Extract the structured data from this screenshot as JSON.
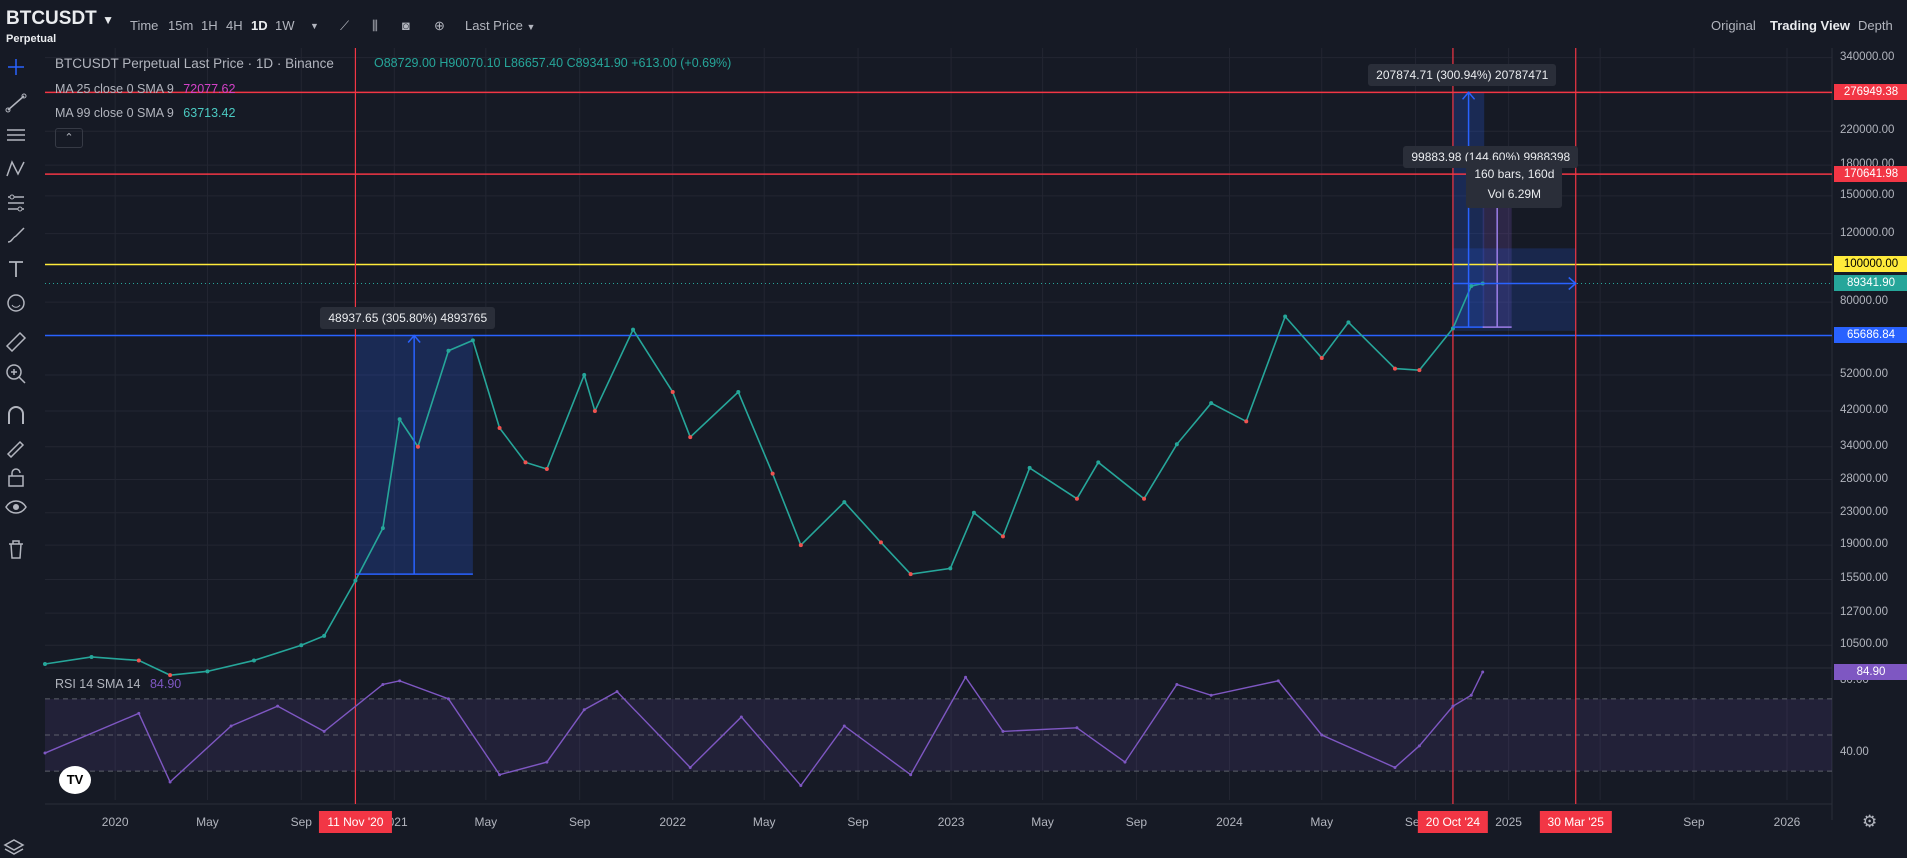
{
  "header": {
    "symbol": "BTCUSDT",
    "contract": "Perpetual",
    "intervals": [
      "Time",
      "15m",
      "1H",
      "4H",
      "1D",
      "1W"
    ],
    "active_interval": "1D",
    "price_type": "Last Price",
    "views": [
      "Original",
      "Trading View",
      "Depth"
    ],
    "active_view": "Trading View"
  },
  "legend": {
    "main_title": "BTCUSDT Perpetual Last Price · 1D · Binance",
    "open": "O88729.00",
    "high": "H90070.10",
    "low": "L86657.40",
    "close": "C89341.90",
    "change": "+613.00 (+0.69%)",
    "ma25_label": "MA 25 close 0 SMA 9",
    "ma25_value": "72077.62",
    "ma99_label": "MA 99 close 0 SMA 9",
    "ma99_value": "63713.42",
    "rsi_label": "RSI 14 SMA 14",
    "rsi_value": "84.90"
  },
  "colors": {
    "background": "#161a25",
    "up": "#26a69a",
    "down": "#ef5350",
    "ma25": "#d442c8",
    "ma99": "#4bc9c1",
    "rsi": "#7e57c2",
    "red_line": "#f23645",
    "yellow_line": "#ffeb3b",
    "blue_line": "#2962ff",
    "current_price": "#26a69a"
  },
  "chart_data": [
    {
      "type": "line",
      "title": "BTCUSDT Perpetual Last Price · 1D · Binance",
      "y_scale": "log",
      "y_ticks": [
        "340000.00",
        "220000.00",
        "180000.00",
        "150000.00",
        "120000.00",
        "80000.00",
        "52000.00",
        "42000.00",
        "34000.00",
        "28000.00",
        "23000.00",
        "19000.00",
        "15500.00",
        "12700.00",
        "10500.00"
      ],
      "ylim": [
        9400,
        360000
      ],
      "x_ticks": [
        "2020",
        "May",
        "Sep",
        "2021",
        "May",
        "Sep",
        "2022",
        "May",
        "Sep",
        "2023",
        "May",
        "Sep",
        "2024",
        "May",
        "Sep",
        "2025",
        "May",
        "Sep",
        "2026"
      ],
      "xlim": [
        "2019-10-01",
        "2026-03-01"
      ],
      "series": [
        {
          "name": "BTCUSDT",
          "x": [
            "2019-10-01",
            "2019-12-01",
            "2020-02-01",
            "2020-03-13",
            "2020-05-01",
            "2020-07-01",
            "2020-09-01",
            "2020-10-01",
            "2020-11-11",
            "2020-12-17",
            "2021-01-08",
            "2021-02-01",
            "2021-03-13",
            "2021-04-14",
            "2021-05-19",
            "2021-06-22",
            "2021-07-20",
            "2021-09-07",
            "2021-09-21",
            "2021-11-10",
            "2022-01-01",
            "2022-01-24",
            "2022-03-28",
            "2022-05-12",
            "2022-06-18",
            "2022-08-14",
            "2022-10-01",
            "2022-11-09",
            "2022-12-31",
            "2023-01-31",
            "2023-03-10",
            "2023-04-14",
            "2023-06-15",
            "2023-07-13",
            "2023-09-11",
            "2023-10-24",
            "2023-12-08",
            "2024-01-23",
            "2024-03-14",
            "2024-05-01",
            "2024-06-05",
            "2024-08-05",
            "2024-09-06",
            "2024-10-20",
            "2024-11-13",
            "2024-11-28"
          ],
          "values": [
            9400,
            9800,
            9600,
            8800,
            9000,
            9600,
            10500,
            11100,
            15400,
            21000,
            40000,
            34000,
            60000,
            63800,
            38000,
            31000,
            29800,
            52000,
            42000,
            68000,
            47000,
            36000,
            47000,
            29000,
            19000,
            24500,
            19300,
            16000,
            16550,
            23000,
            20000,
            30000,
            25000,
            31000,
            25000,
            34500,
            44000,
            39500,
            73500,
            57500,
            71000,
            54000,
            53500,
            68500,
            88000,
            89341.9
          ]
        }
      ],
      "horizontal_levels": [
        {
          "value": 276949.38,
          "label": "276949.38",
          "color": "#f23645"
        },
        {
          "value": 170641.98,
          "label": "170641.98",
          "color": "#f23645"
        },
        {
          "value": 100000.0,
          "label": "100000.00",
          "color": "#ffeb3b"
        },
        {
          "value": 65686.84,
          "label": "65686.84",
          "color": "#2962ff"
        }
      ],
      "current_price": {
        "value": 89341.9,
        "label": "89341.90"
      },
      "vertical_markers": [
        {
          "date": "2020-11-11",
          "label": "11 Nov '20"
        },
        {
          "date": "2024-10-20",
          "label": "20 Oct '24"
        },
        {
          "date": "2025-03-30",
          "label": "30 Mar '25"
        }
      ],
      "measurements": [
        {
          "label": "48937.65 (305.80%) 4893765",
          "from_date": "2020-11-11",
          "to_date": "2021-04-14",
          "from_value": 16000,
          "to_value": 65686.84
        },
        {
          "label": "207874.71 (300.94%) 20787471",
          "from_date": "2024-10-20",
          "to_date": "2024-11-30",
          "from_value": 69000,
          "to_value": 276949.38
        },
        {
          "label": "99883.98 (144.60%) 9988398",
          "from_date": "2024-11-28",
          "to_date": "2025-01-05",
          "from_value": 69000,
          "to_value": 170641.98
        }
      ],
      "range_box": {
        "from_date": "2024-10-20",
        "to_date": "2025-03-30",
        "from_value": 67500,
        "to_value": 110000,
        "bars_label": "160 bars, 160d",
        "vol_label": "Vol 6.29M"
      }
    },
    {
      "type": "line",
      "title": "RSI 14 SMA 14",
      "y_ticks": [
        "80.00",
        "40.00"
      ],
      "ylim": [
        14,
        86
      ],
      "bands": [
        70,
        50,
        30
      ],
      "series": [
        {
          "name": "RSI 14",
          "x": [
            "2019-10-01",
            "2020-02-01",
            "2020-03-13",
            "2020-06-01",
            "2020-08-01",
            "2020-10-01",
            "2020-12-17",
            "2021-01-08",
            "2021-03-13",
            "2021-05-19",
            "2021-07-20",
            "2021-09-07",
            "2021-10-20",
            "2022-01-24",
            "2022-04-01",
            "2022-06-18",
            "2022-08-14",
            "2022-11-09",
            "2023-01-20",
            "2023-03-10",
            "2023-06-15",
            "2023-08-17",
            "2023-10-24",
            "2023-12-08",
            "2024-03-05",
            "2024-05-01",
            "2024-08-05",
            "2024-09-06",
            "2024-10-20",
            "2024-11-13",
            "2024-11-28"
          ],
          "values": [
            40,
            62,
            24,
            55,
            66,
            52,
            78,
            80,
            70,
            28,
            35,
            64,
            74,
            32,
            60,
            22,
            55,
            28,
            82,
            52,
            54,
            35,
            78,
            72,
            80,
            50,
            32,
            44,
            66,
            72,
            84.9
          ]
        }
      ],
      "current_value": {
        "value": 84.9,
        "label": "84.90"
      }
    }
  ]
}
